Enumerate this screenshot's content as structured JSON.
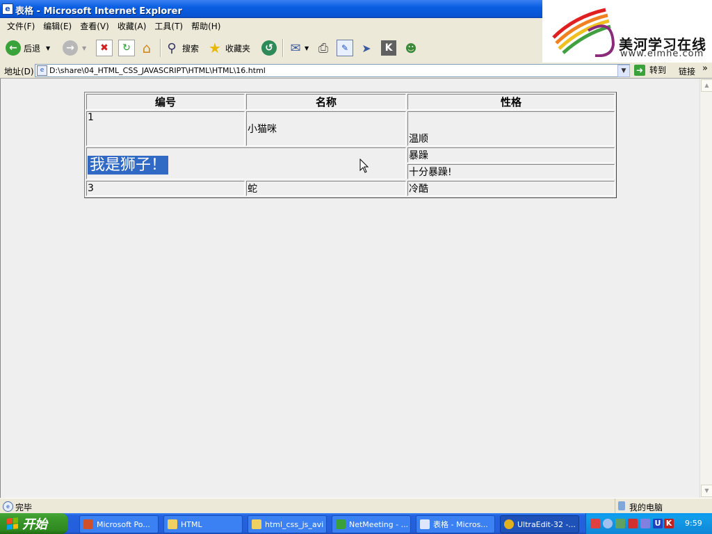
{
  "window": {
    "title": "表格 - Microsoft Internet Explorer"
  },
  "menu": [
    "文件(F)",
    "编辑(E)",
    "查看(V)",
    "收藏(A)",
    "工具(T)",
    "帮助(H)"
  ],
  "toolbar": {
    "back_label": "后退",
    "search_label": "搜索",
    "favorites_label": "收藏夹"
  },
  "logo": {
    "brand": "美河学习在线",
    "url": "www.eimhe.com"
  },
  "address": {
    "label": "地址(D)",
    "value": "D:\\share\\04_HTML_CSS_JAVASCRIPT\\HTML\\HTML\\16.html",
    "go_label": "转到",
    "links_label": "链接"
  },
  "table": {
    "headers": [
      "编号",
      "名称",
      "性格"
    ],
    "row1": {
      "id": "1",
      "name": "小猫咪",
      "trait": "温顺"
    },
    "merged_text": "我是狮子！",
    "row2_trait": "暴躁",
    "row3_trait": "十分暴躁!",
    "row4": {
      "id": "3",
      "name": "蛇",
      "trait": "冷酷"
    }
  },
  "status": {
    "text": "完毕",
    "zone": "我的电脑"
  },
  "taskbar": {
    "start_label": "开始",
    "tasks": [
      "Microsoft Po...",
      "HTML",
      "html_css_js_avi",
      "NetMeeting - ...",
      "表格 - Micros...",
      "UltraEdit-32 -..."
    ],
    "clock": "9:59"
  },
  "colors": {
    "titlebar": "#0a5ee0",
    "selection": "#316ac5",
    "taskbar": "#245edb",
    "start": "#3c9a2c"
  }
}
